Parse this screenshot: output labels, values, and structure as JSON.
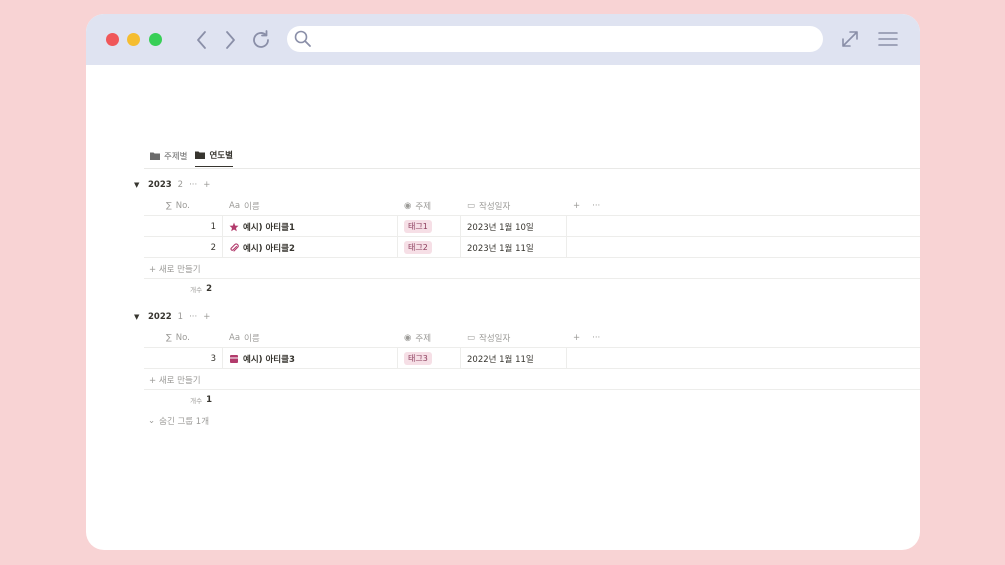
{
  "browser": {
    "nav_icons": [
      "chevron-left-icon",
      "chevron-right-icon",
      "reload-icon"
    ],
    "url_value": "",
    "toolbar_icons": [
      "expand-icon",
      "menu-icon"
    ]
  },
  "view_tabs": [
    {
      "label": "주제별",
      "active": false
    },
    {
      "label": "연도별",
      "active": true
    }
  ],
  "columns": {
    "no": "No.",
    "name": "이름",
    "name_prefix": "Aa",
    "topic": "주제",
    "date": "작성일자",
    "add": "+",
    "more": "···"
  },
  "groups": [
    {
      "year": "2023",
      "count": "2",
      "more": "···",
      "add": "+",
      "rows": [
        {
          "no": "1",
          "icon": "star-icon",
          "name": "예시) 아티클1",
          "topic": "태그1",
          "date": "2023년 1월 10일"
        },
        {
          "no": "2",
          "icon": "paperclip-icon",
          "name": "예시) 아티클2",
          "topic": "태그2",
          "date": "2023년 1월 11일"
        }
      ],
      "new_label": "+ 새로 만들기",
      "count_label": "개수",
      "count_value": "2"
    },
    {
      "year": "2022",
      "count": "1",
      "more": "···",
      "add": "+",
      "rows": [
        {
          "no": "3",
          "icon": "box-icon",
          "name": "예시) 아티클3",
          "topic": "태그3",
          "date": "2022년 1월 11일"
        }
      ],
      "new_label": "+ 새로 만들기",
      "count_label": "개수",
      "count_value": "1"
    }
  ],
  "hidden_groups_label": "숨긴 그룹 1개",
  "colors": {
    "background": "#f8d3d4",
    "titlebar": "#dfe3f1",
    "tag_bg": "#f6dfe6",
    "tag_text": "#8a3b5b",
    "icon_accent": "#b23b6c"
  }
}
